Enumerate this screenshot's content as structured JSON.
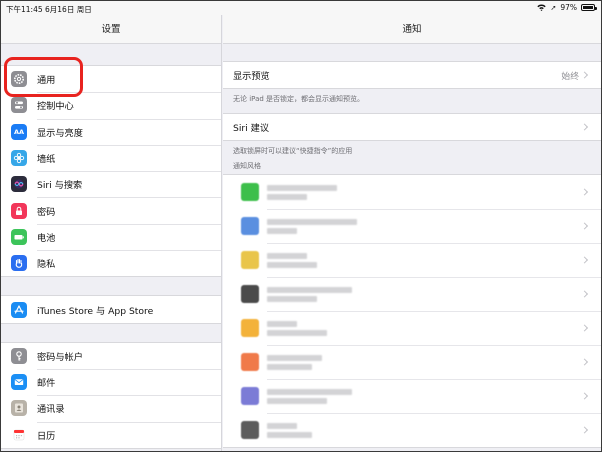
{
  "status_bar": {
    "time_date": "下午11:45  6月16日 周日",
    "battery": "97%",
    "battery_level": 0.97
  },
  "sidebar": {
    "title": "设置",
    "groups": [
      {
        "items": [
          {
            "label": "通用",
            "icon": "gear-icon",
            "color": "#8e8e93"
          },
          {
            "label": "控制中心",
            "icon": "toggles-icon",
            "color": "#8e8e93"
          },
          {
            "label": "显示与亮度",
            "icon": "text-size-icon",
            "color": "#1a7cf5",
            "glyph": "AA"
          },
          {
            "label": "墙纸",
            "icon": "flower-icon",
            "color": "#36a7e8"
          },
          {
            "label": "Siri 与搜索",
            "icon": "siri-icon",
            "color": "#2c2c3c"
          },
          {
            "label": "密码",
            "icon": "lock-icon",
            "color": "#f2365a"
          },
          {
            "label": "电池",
            "icon": "battery-icon",
            "color": "#3cc45a"
          },
          {
            "label": "隐私",
            "icon": "hand-icon",
            "color": "#2a6ef0"
          }
        ]
      },
      {
        "items": [
          {
            "label": "iTunes Store 与 App Store",
            "icon": "app-store-icon",
            "color": "#1a8cf3"
          }
        ]
      },
      {
        "items": [
          {
            "label": "密码与帐户",
            "icon": "key-icon",
            "color": "#8e8e93"
          },
          {
            "label": "邮件",
            "icon": "mail-icon",
            "color": "#1b8ff5"
          },
          {
            "label": "通讯录",
            "icon": "contacts-icon",
            "color": "#b8b2a8"
          },
          {
            "label": "日历",
            "icon": "calendar-icon",
            "color": "#ffffff"
          }
        ]
      }
    ]
  },
  "main": {
    "title": "通知",
    "preview": {
      "label": "显示预览",
      "value": "始终",
      "footnote": "无论 iPad 是否锁定，都会显示通知预览。"
    },
    "siri": {
      "label": "Siri 建议",
      "footnote": "选取锁屏时可以建议“快捷指令”的应用"
    },
    "style_header": "通知风格",
    "apps": [
      {
        "color": "#3dbf4b"
      },
      {
        "color": "#5a8fe0"
      },
      {
        "color": "#e9c54a"
      },
      {
        "color": "#4a4a4a"
      },
      {
        "color": "#f3b23a"
      },
      {
        "color": "#f07a4a"
      },
      {
        "color": "#7b7bd6"
      },
      {
        "color": "#5c5c5c"
      }
    ]
  }
}
